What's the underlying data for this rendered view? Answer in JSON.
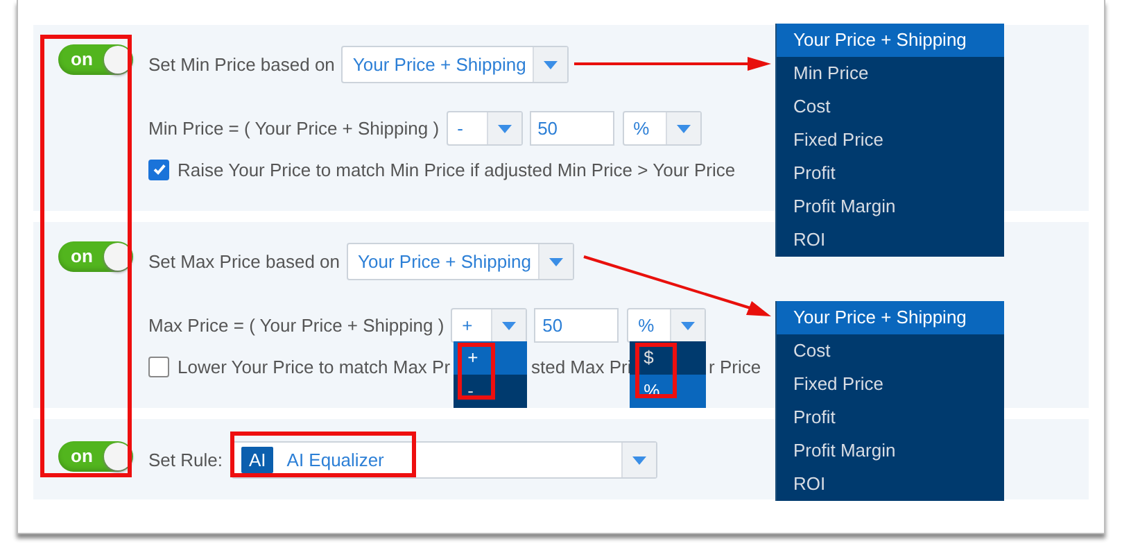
{
  "sections": [
    {
      "kind": "price_bound",
      "toggle": {
        "label": "on",
        "on": true
      },
      "label": "Set Min Price based on",
      "basis": {
        "value": "Your Price + Shipping",
        "options": [
          {
            "label": "Your Price + Shipping",
            "selected": true
          },
          {
            "label": "Min Price",
            "selected": false
          },
          {
            "label": "Cost",
            "selected": false
          },
          {
            "label": "Fixed Price",
            "selected": false
          },
          {
            "label": "Profit",
            "selected": false
          },
          {
            "label": "Profit Margin",
            "selected": false
          },
          {
            "label": "ROI",
            "selected": false
          }
        ]
      },
      "formula": {
        "label": "Min Price = ( Your Price + Shipping )",
        "operator": {
          "value": "-"
        },
        "amount": "50",
        "unit": {
          "value": "%"
        }
      },
      "checkbox": {
        "checked": true,
        "label_parts": [
          "Raise Your Price to match Min Price if adjusted Min Price > Your Price"
        ]
      }
    },
    {
      "kind": "price_bound",
      "toggle": {
        "label": "on",
        "on": true
      },
      "label": "Set Max Price based on",
      "basis": {
        "value": "Your Price + Shipping",
        "options": [
          {
            "label": "Your Price + Shipping",
            "selected": true
          },
          {
            "label": "Cost",
            "selected": false
          },
          {
            "label": "Fixed Price",
            "selected": false
          },
          {
            "label": "Profit",
            "selected": false
          },
          {
            "label": "Profit Margin",
            "selected": false
          },
          {
            "label": "ROI",
            "selected": false
          }
        ]
      },
      "formula": {
        "label": "Max Price = ( Your Price + Shipping )",
        "operator": {
          "value": "+",
          "options": [
            {
              "label": "+",
              "selected": true
            },
            {
              "label": "-",
              "selected": false
            }
          ]
        },
        "amount": "50",
        "unit": {
          "value": "%",
          "options": [
            {
              "label": "$",
              "selected": false
            },
            {
              "label": "%",
              "selected": true
            }
          ]
        }
      },
      "checkbox": {
        "checked": false,
        "label_parts": [
          "Lower Your Price to match Max Pr",
          "sted Max Pri",
          "r Price"
        ]
      }
    },
    {
      "kind": "rule",
      "toggle": {
        "label": "on",
        "on": true
      },
      "label": "Set Rule:",
      "rule": {
        "badge": "AI",
        "value": "AI Equalizer"
      }
    }
  ]
}
